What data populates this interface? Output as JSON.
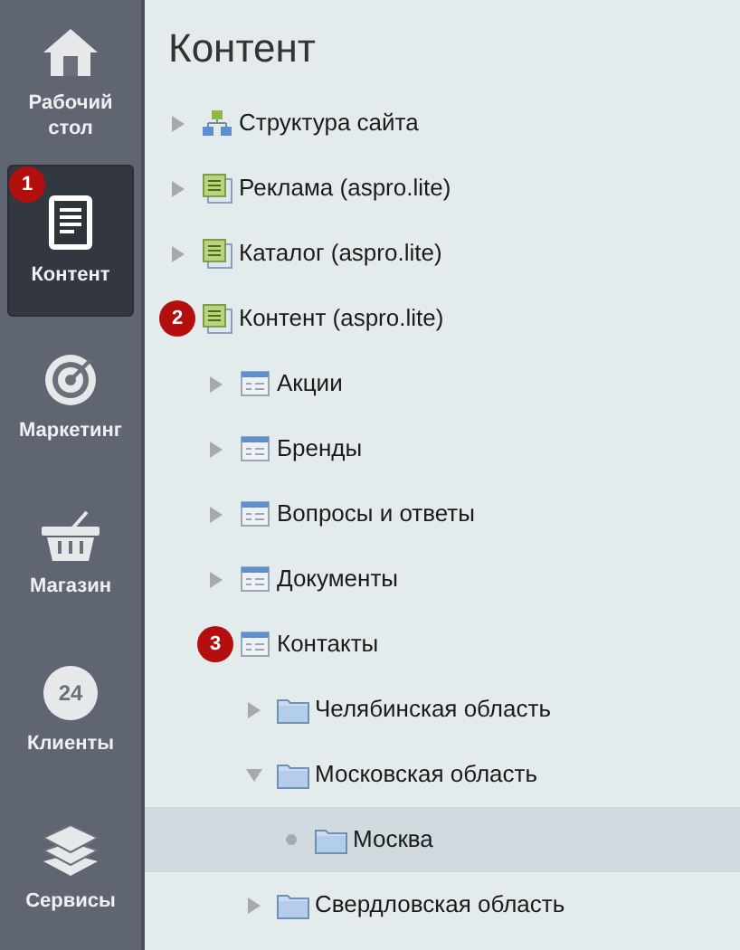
{
  "sidebar": {
    "items": [
      {
        "kind": "home",
        "label": "Рабочий стол",
        "selected": false
      },
      {
        "kind": "document",
        "label": "Контент",
        "selected": true,
        "badge": "1"
      },
      {
        "kind": "target",
        "label": "Маркетинг",
        "selected": false
      },
      {
        "kind": "basket",
        "label": "Магазин",
        "selected": false
      },
      {
        "kind": "cloud",
        "label": "Клиенты",
        "selected": false,
        "icon_text": "24"
      },
      {
        "kind": "layers",
        "label": "Сервисы",
        "selected": false
      }
    ]
  },
  "title": "Контент",
  "tree": [
    {
      "label": "Структура сайта",
      "kind": "structure",
      "expanded": false,
      "selected": false
    },
    {
      "label": "Реклама (aspro.lite)",
      "kind": "section",
      "expanded": false,
      "selected": false
    },
    {
      "label": "Каталог (aspro.lite)",
      "kind": "section",
      "expanded": false,
      "selected": false
    },
    {
      "label": "Контент (aspro.lite)",
      "kind": "section",
      "expanded": true,
      "selected": false,
      "badge": "2",
      "children": [
        {
          "label": "Акции",
          "kind": "list",
          "expanded": false,
          "selected": false
        },
        {
          "label": "Бренды",
          "kind": "list",
          "expanded": false,
          "selected": false
        },
        {
          "label": "Вопросы и ответы",
          "kind": "list",
          "expanded": false,
          "selected": false
        },
        {
          "label": "Документы",
          "kind": "list",
          "expanded": false,
          "selected": false
        },
        {
          "label": "Контакты",
          "kind": "list",
          "expanded": true,
          "selected": false,
          "badge": "3",
          "children": [
            {
              "label": "Челябинская область",
              "kind": "folder",
              "expanded": false,
              "selected": false
            },
            {
              "label": "Московская область",
              "kind": "folder",
              "expanded": true,
              "selected": false,
              "children": [
                {
                  "label": "Москва",
                  "kind": "folder",
                  "selected": true
                }
              ]
            },
            {
              "label": "Свердловская область",
              "kind": "folder",
              "expanded": false,
              "selected": false
            }
          ]
        }
      ]
    }
  ]
}
